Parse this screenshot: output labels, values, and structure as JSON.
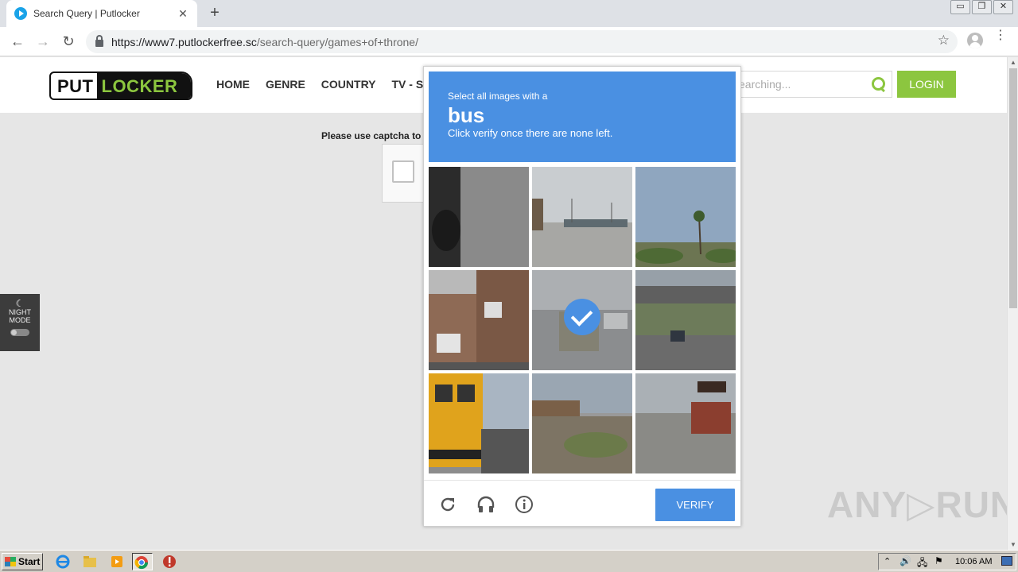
{
  "browser": {
    "tab_title": "Search Query | Putlocker",
    "tab_close": "✕",
    "new_tab": "+",
    "url_host": "https://www7.putlockerfree.sc",
    "url_path": "/search-query/games+of+throne/",
    "star": "☆",
    "back": "←",
    "forward": "→",
    "reload": "↻",
    "menu": "⋮",
    "win_min": "▭",
    "win_restore": "❐",
    "win_close": "✕"
  },
  "site": {
    "logo_put": "PUT",
    "logo_locker": "LOCKER",
    "nav": [
      "HOME",
      "GENRE",
      "COUNTRY",
      "TV - SER"
    ],
    "search_placeholder": "earching...",
    "login_label": "LOGIN",
    "captcha_prompt": "Please use captcha to",
    "night_icon": "☾",
    "night_label_1": "NIGHT",
    "night_label_2": "MODE"
  },
  "challenge": {
    "pre": "Select all images with a",
    "target": "bus",
    "sub": "Click verify once there are none left.",
    "verify_label": "VERIFY",
    "tiles": [
      {
        "scene": "car-closeup",
        "selected": false
      },
      {
        "scene": "parking-lot",
        "selected": false
      },
      {
        "scene": "palm-tree",
        "selected": false
      },
      {
        "scene": "brick-house",
        "selected": false
      },
      {
        "scene": "highway-truck",
        "selected": true
      },
      {
        "scene": "overpass",
        "selected": false
      },
      {
        "scene": "school-bus",
        "selected": false
      },
      {
        "scene": "roadside",
        "selected": false
      },
      {
        "scene": "road-bus",
        "selected": false
      }
    ]
  },
  "watermark": "ANY▷RUN",
  "taskbar": {
    "start_label": "Start",
    "clock": "10:06 AM"
  },
  "colors": {
    "brand_green": "#8cc63f",
    "captcha_blue": "#4a90e2"
  }
}
